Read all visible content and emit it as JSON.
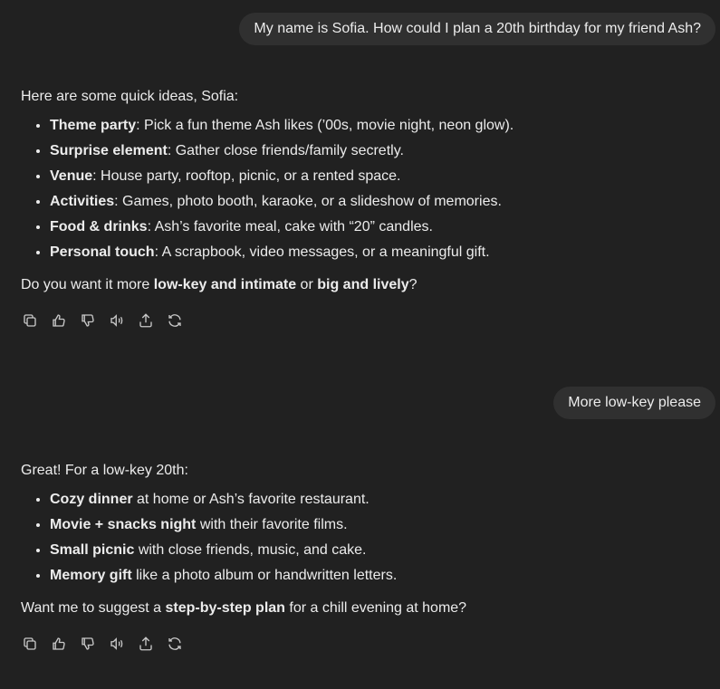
{
  "messages": [
    {
      "role": "user",
      "text": "My name is Sofia. How could I plan a 20th birthday for my friend Ash?"
    },
    {
      "role": "assistant",
      "intro": "Here are some quick ideas, Sofia:",
      "items": [
        {
          "bold": "Theme party",
          "rest": ": Pick a fun theme Ash likes (’00s, movie night, neon glow)."
        },
        {
          "bold": "Surprise element",
          "rest": ": Gather close friends/family secretly."
        },
        {
          "bold": "Venue",
          "rest": ": House party, rooftop, picnic, or a rented space."
        },
        {
          "bold": "Activities",
          "rest": ": Games, photo booth, karaoke, or a slideshow of memories."
        },
        {
          "bold": "Food & drinks",
          "rest": ": Ash’s favorite meal, cake with “20” candles."
        },
        {
          "bold": "Personal touch",
          "rest": ": A scrapbook, video messages, or a meaningful gift."
        }
      ],
      "closing": {
        "p1": "Do you want it more ",
        "b1": "low-key and intimate",
        "p2": " or ",
        "b2": "big and lively",
        "p3": "?"
      }
    },
    {
      "role": "user",
      "text": "More low-key please"
    },
    {
      "role": "assistant",
      "intro": "Great! For a low-key 20th:",
      "items": [
        {
          "bold": "Cozy dinner",
          "rest": " at home or Ash’s favorite restaurant."
        },
        {
          "bold": "Movie + snacks night",
          "rest": " with their favorite films."
        },
        {
          "bold": "Small picnic",
          "rest": " with close friends, music, and cake."
        },
        {
          "bold": "Memory gift",
          "rest": " like a photo album or handwritten letters."
        }
      ],
      "closing": {
        "p1": "Want me to suggest a ",
        "b1": "step-by-step plan",
        "p2": " for a chill evening at home?"
      }
    }
  ],
  "action_icons": [
    "copy-icon",
    "thumbs-up-icon",
    "thumbs-down-icon",
    "read-aloud-icon",
    "share-icon",
    "regenerate-icon"
  ]
}
